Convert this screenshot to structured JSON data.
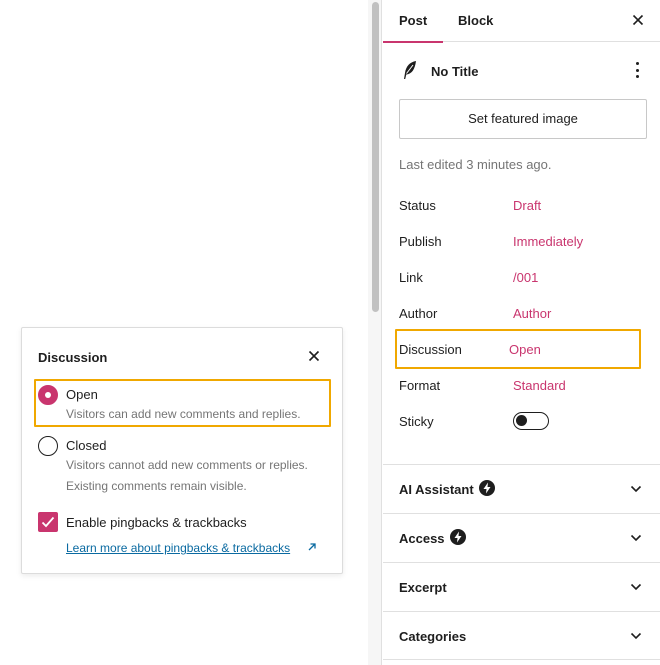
{
  "sidebar": {
    "tabs": [
      {
        "label": "Post"
      },
      {
        "label": "Block"
      }
    ],
    "post_title": "No Title",
    "featured_image_label": "Set featured image",
    "last_edited": "Last edited 3 minutes ago.",
    "meta": {
      "status": {
        "label": "Status",
        "value": "Draft"
      },
      "publish": {
        "label": "Publish",
        "value": "Immediately"
      },
      "link": {
        "label": "Link",
        "value": "/001"
      },
      "author": {
        "label": "Author",
        "value": "Author"
      },
      "discussion": {
        "label": "Discussion",
        "value": "Open"
      },
      "format": {
        "label": "Format",
        "value": "Standard"
      },
      "sticky": {
        "label": "Sticky",
        "on": false
      }
    },
    "panels": [
      {
        "title": "AI Assistant"
      },
      {
        "title": "Access"
      },
      {
        "title": "Excerpt"
      },
      {
        "title": "Categories"
      }
    ]
  },
  "popover": {
    "title": "Discussion",
    "options": [
      {
        "label": "Open",
        "help": "Visitors can add new comments and replies.",
        "selected": true
      },
      {
        "label": "Closed",
        "help": "Visitors cannot add new comments or replies. Existing comments remain visible.",
        "selected": false
      }
    ],
    "pingbacks_label": "Enable pingbacks & trackbacks",
    "pingbacks_checked": true,
    "learn_more": "Learn more about pingbacks & trackbacks"
  },
  "colors": {
    "accent": "#c9356e",
    "highlight": "#f0a800",
    "link": "#0a6aa1",
    "muted": "#757575"
  },
  "icons": [
    "feather-icon",
    "more-vertical-icon",
    "close-icon",
    "bolt-icon",
    "chevron-down-icon",
    "checkmark-icon",
    "external-link-icon"
  ]
}
